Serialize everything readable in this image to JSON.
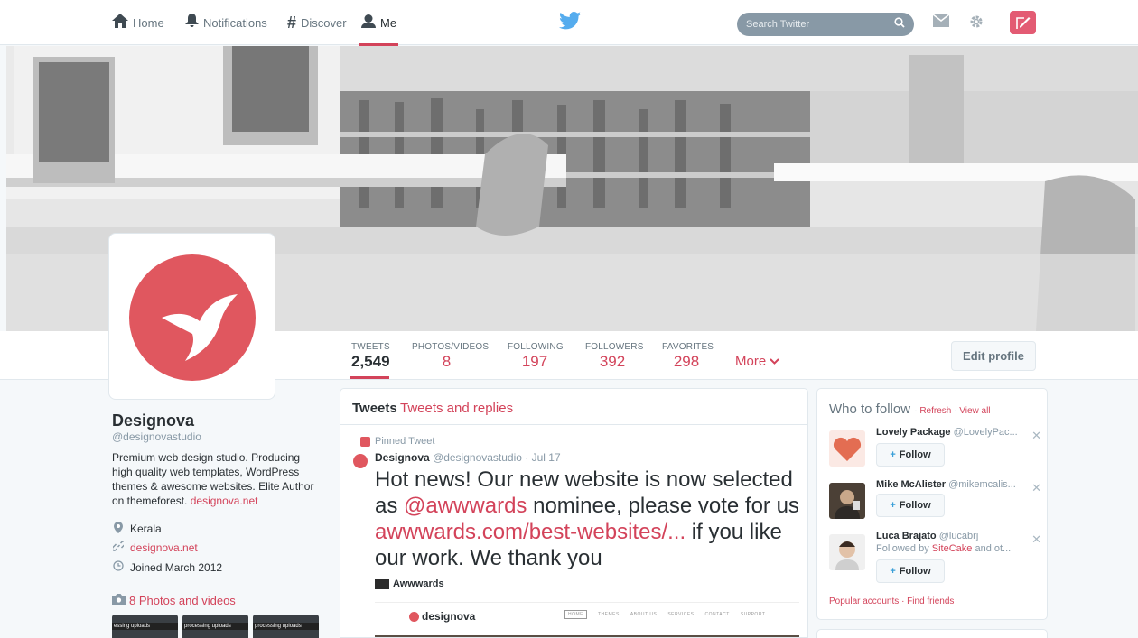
{
  "nav": {
    "home": "Home",
    "notifications": "Notifications",
    "discover": "Discover",
    "me": "Me",
    "search_placeholder": "Search Twitter"
  },
  "stats": [
    {
      "label": "TWEETS",
      "value": "2,549"
    },
    {
      "label": "PHOTOS/VIDEOS",
      "value": "8"
    },
    {
      "label": "FOLLOWING",
      "value": "197"
    },
    {
      "label": "FOLLOWERS",
      "value": "392"
    },
    {
      "label": "FAVORITES",
      "value": "298"
    }
  ],
  "more_label": "More",
  "edit_profile": "Edit profile",
  "profile": {
    "name": "Designova",
    "handle": "@designovastudio",
    "bio": "Premium web design studio. Producing high quality web templates, WordPress themes & awesome websites. Elite Author on themeforest.",
    "bio_link": "designova.net",
    "location": "Kerala",
    "website": "designova.net",
    "joined": "Joined March 2012",
    "photos_link": "8 Photos and videos",
    "thumb_label": "processing uploads",
    "thumb_label_first": "essing uploads"
  },
  "timeline": {
    "tab_tweets": "Tweets",
    "tab_replies": "Tweets and replies",
    "pinned": "Pinned Tweet",
    "author": "Designova",
    "author_meta": "@designovastudio · Jul 17",
    "text_1": "Hot news! Our new website is now selected as ",
    "mention": "@awwwards",
    "text_2": " nominee, please vote for us ",
    "link": "awwwards.com/best-websites/...",
    "text_3": " if you like our work. We thank you",
    "card_source": "Awwwards",
    "preview_logo": "designova",
    "preview_nav": [
      "HOME",
      "THEMES",
      "ABOUT US",
      "SERVICES",
      "CONTACT",
      "SUPPORT"
    ]
  },
  "who_to_follow": {
    "title": "Who to follow",
    "refresh": "Refresh",
    "view_all": "View all",
    "follow_label": "Follow",
    "suggestions": [
      {
        "name": "Lovely Package",
        "handle": "@LovelyPac...",
        "sub": ""
      },
      {
        "name": "Mike McAlister",
        "handle": "@mikemcalis...",
        "sub": ""
      },
      {
        "name": "Luca Brajato",
        "handle": "@lucabrj",
        "sub_pre": "Followed by ",
        "sub_link": "SiteCake",
        "sub_post": " and ot..."
      }
    ],
    "popular": "Popular accounts",
    "find_friends": "Find friends"
  },
  "colors": {
    "accent": "#d3435a",
    "avatar_red": "#e0575f",
    "link_blue": "#55acee"
  }
}
